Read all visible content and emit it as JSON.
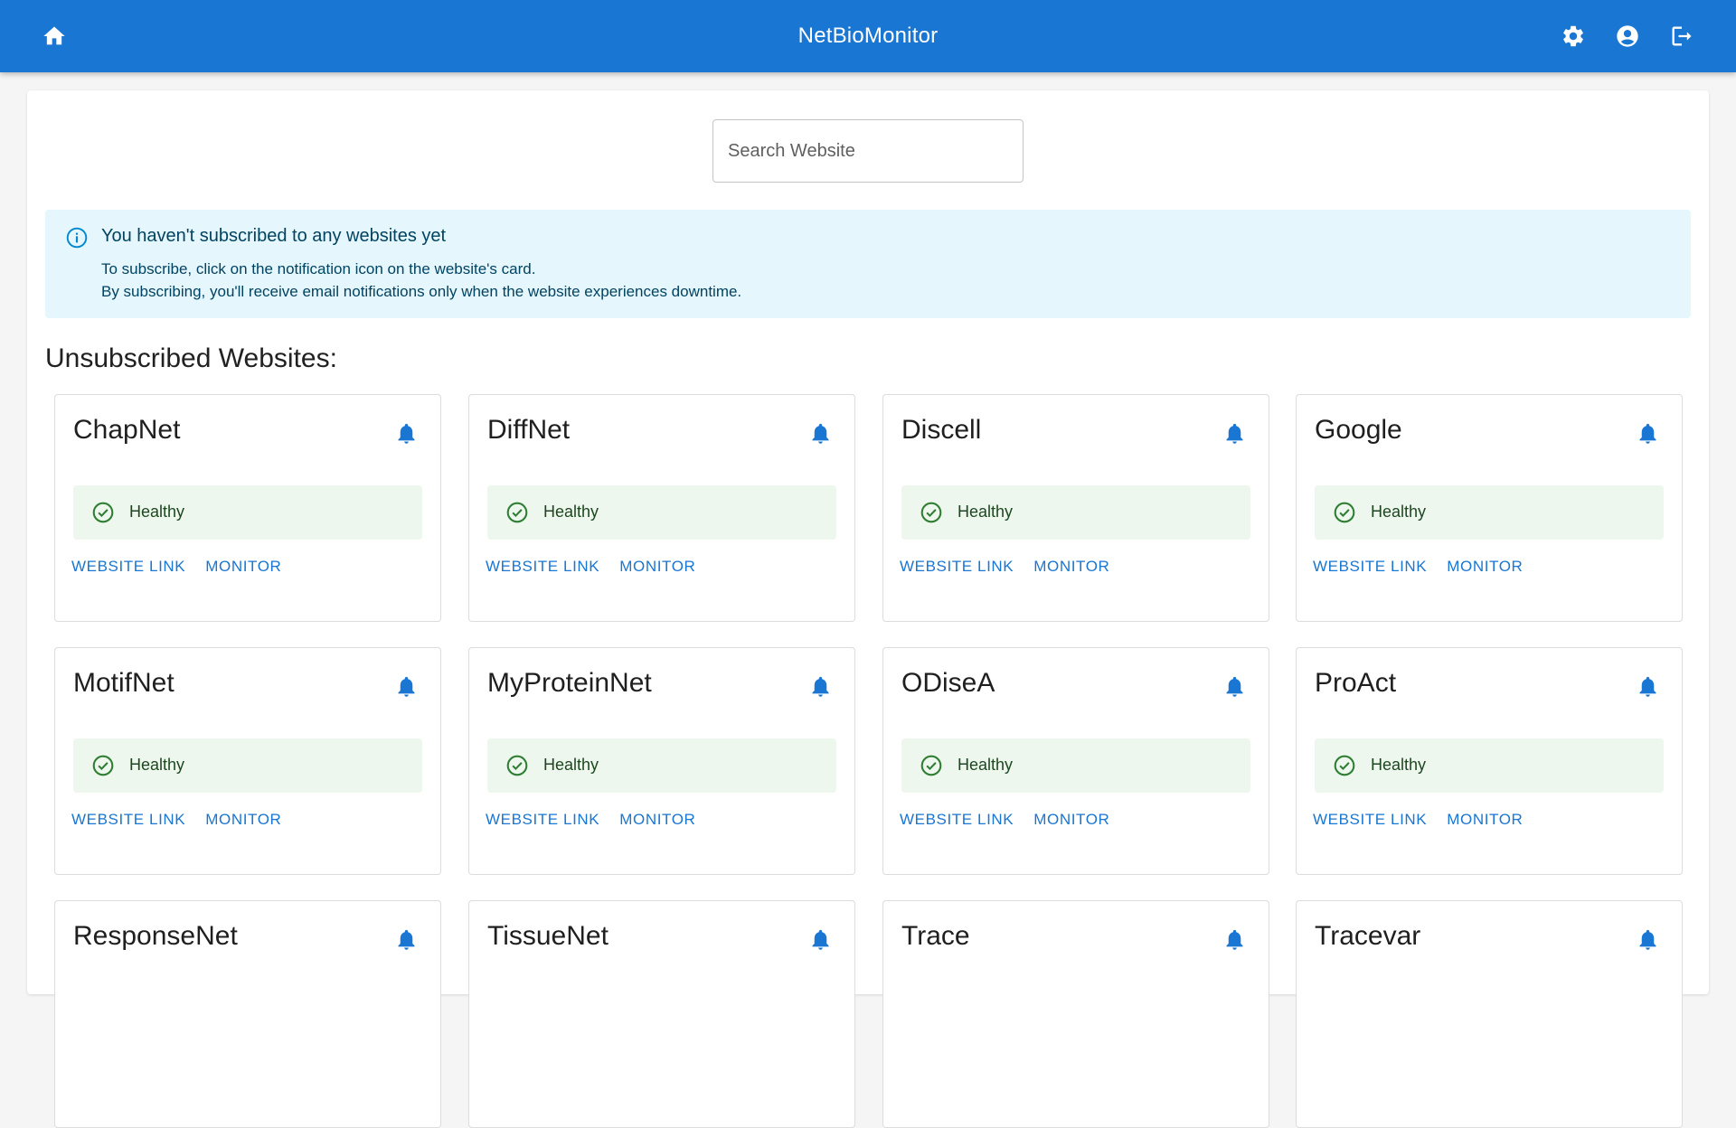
{
  "app": {
    "title": "NetBioMonitor"
  },
  "header": {
    "home_icon": "home-icon",
    "settings_icon": "gear-icon",
    "account_icon": "account-circle-icon",
    "logout_icon": "logout-icon"
  },
  "search": {
    "placeholder": "Search Website",
    "value": ""
  },
  "alert": {
    "icon": "info-icon",
    "title": "You haven't subscribed to any websites yet",
    "line1": "To subscribe, click on the notification icon on the website's card.",
    "line2": "By subscribing, you'll receive email notifications only when the website experiences downtime."
  },
  "section": {
    "title": "Unsubscribed Websites:"
  },
  "colors": {
    "primary": "#1976d2",
    "healthy_bg": "#edf7ed",
    "healthy_text": "#1e4620",
    "info_bg": "#e5f6fd"
  },
  "cards": [
    {
      "name": "ChapNet",
      "status": "Healthy",
      "link_label": "WEBSITE LINK",
      "monitor_label": "MONITOR"
    },
    {
      "name": "DiffNet",
      "status": "Healthy",
      "link_label": "WEBSITE LINK",
      "monitor_label": "MONITOR"
    },
    {
      "name": "Discell",
      "status": "Healthy",
      "link_label": "WEBSITE LINK",
      "monitor_label": "MONITOR"
    },
    {
      "name": "Google",
      "status": "Healthy",
      "link_label": "WEBSITE LINK",
      "monitor_label": "MONITOR"
    },
    {
      "name": "MotifNet",
      "status": "Healthy",
      "link_label": "WEBSITE LINK",
      "monitor_label": "MONITOR"
    },
    {
      "name": "MyProteinNet",
      "status": "Healthy",
      "link_label": "WEBSITE LINK",
      "monitor_label": "MONITOR"
    },
    {
      "name": "ODiseA",
      "status": "Healthy",
      "link_label": "WEBSITE LINK",
      "monitor_label": "MONITOR"
    },
    {
      "name": "ProAct",
      "status": "Healthy",
      "link_label": "WEBSITE LINK",
      "monitor_label": "MONITOR"
    },
    {
      "name": "ResponseNet"
    },
    {
      "name": "TissueNet"
    },
    {
      "name": "Trace"
    },
    {
      "name": "Tracevar"
    }
  ]
}
